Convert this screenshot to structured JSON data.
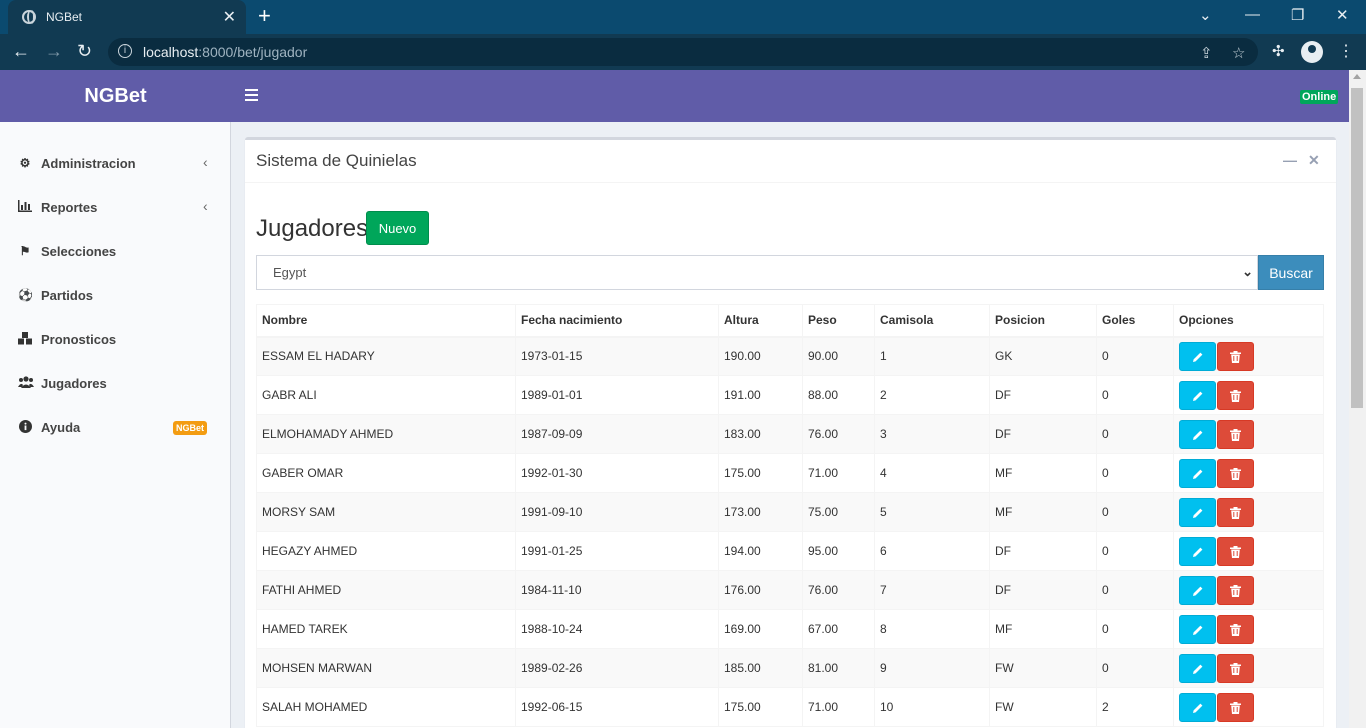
{
  "browser": {
    "tab_title": "NGBet",
    "url_host": "localhost",
    "url_rest": ":8000/bet/jugador"
  },
  "header": {
    "logo": "NGBet",
    "status": "Online"
  },
  "sidebar": {
    "items": [
      {
        "label": "Administracion",
        "icon": "gear-icon",
        "has_chevron": true
      },
      {
        "label": "Reportes",
        "icon": "bar-chart-icon",
        "has_chevron": true
      },
      {
        "label": "Selecciones",
        "icon": "flag-icon",
        "has_chevron": false
      },
      {
        "label": "Partidos",
        "icon": "soccer-ball-icon",
        "has_chevron": false
      },
      {
        "label": "Pronosticos",
        "icon": "cubes-icon",
        "has_chevron": false
      },
      {
        "label": "Jugadores",
        "icon": "users-icon",
        "has_chevron": false
      },
      {
        "label": "Ayuda",
        "icon": "info-icon",
        "has_chevron": false,
        "badge": "NGBet"
      }
    ]
  },
  "box": {
    "title": "Sistema de Quinielas"
  },
  "page": {
    "heading": "Jugadores",
    "new_button": "Nuevo",
    "country_selected": "Egypt",
    "search_button": "Buscar"
  },
  "table": {
    "headers": [
      "Nombre",
      "Fecha nacimiento",
      "Altura",
      "Peso",
      "Camisola",
      "Posicion",
      "Goles",
      "Opciones"
    ],
    "rows": [
      [
        "ESSAM EL HADARY",
        "1973-01-15",
        "190.00",
        "90.00",
        "1",
        "GK",
        "0"
      ],
      [
        "GABR ALI",
        "1989-01-01",
        "191.00",
        "88.00",
        "2",
        "DF",
        "0"
      ],
      [
        "ELMOHAMADY AHMED",
        "1987-09-09",
        "183.00",
        "76.00",
        "3",
        "DF",
        "0"
      ],
      [
        "GABER OMAR",
        "1992-01-30",
        "175.00",
        "71.00",
        "4",
        "MF",
        "0"
      ],
      [
        "MORSY SAM",
        "1991-09-10",
        "173.00",
        "75.00",
        "5",
        "MF",
        "0"
      ],
      [
        "HEGAZY AHMED",
        "1991-01-25",
        "194.00",
        "95.00",
        "6",
        "DF",
        "0"
      ],
      [
        "FATHI AHMED",
        "1984-11-10",
        "176.00",
        "76.00",
        "7",
        "DF",
        "0"
      ],
      [
        "HAMED TAREK",
        "1988-10-24",
        "169.00",
        "67.00",
        "8",
        "MF",
        "0"
      ],
      [
        "MOHSEN MARWAN",
        "1989-02-26",
        "185.00",
        "81.00",
        "9",
        "FW",
        "0"
      ],
      [
        "SALAH MOHAMED",
        "1992-06-15",
        "175.00",
        "71.00",
        "10",
        "FW",
        "2"
      ]
    ]
  },
  "colors": {
    "header": "#605ca8",
    "success": "#00a65a",
    "primary": "#3c8dbc",
    "info": "#00c0ef",
    "danger": "#dd4b39",
    "warning": "#f39c12"
  }
}
